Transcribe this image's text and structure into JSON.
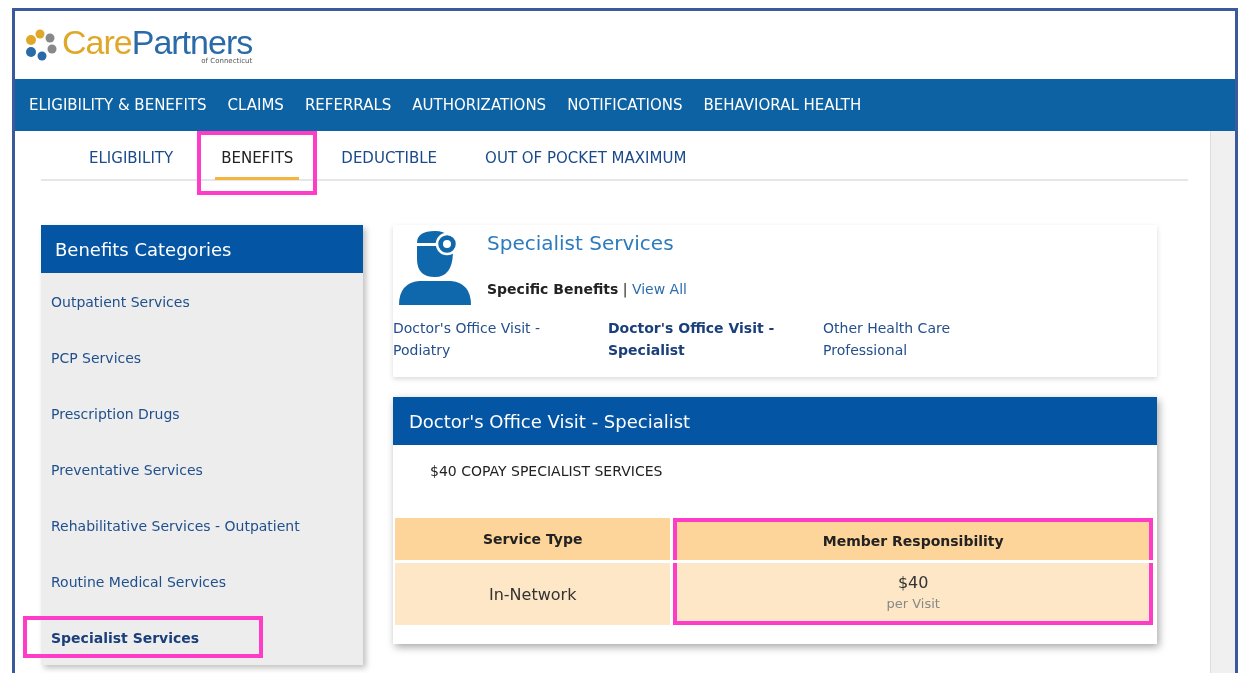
{
  "logo": {
    "first": "Care",
    "second": "Partners",
    "tagline": "of Connecticut"
  },
  "nav": [
    "ELIGIBILITY & BENEFITS",
    "CLAIMS",
    "REFERRALS",
    "AUTHORIZATIONS",
    "NOTIFICATIONS",
    "BEHAVIORAL HEALTH"
  ],
  "tabs": [
    {
      "label": "ELIGIBILITY",
      "selected": false,
      "highlighted": false
    },
    {
      "label": "BENEFITS",
      "selected": true,
      "highlighted": true
    },
    {
      "label": "DEDUCTIBLE",
      "selected": false,
      "highlighted": false
    },
    {
      "label": "OUT OF POCKET MAXIMUM",
      "selected": false,
      "highlighted": false
    }
  ],
  "sidebar": {
    "title": "Benefits Categories",
    "items": [
      {
        "label": "Outpatient Services",
        "selected": false,
        "highlighted": false
      },
      {
        "label": "PCP Services",
        "selected": false,
        "highlighted": false
      },
      {
        "label": "Prescription Drugs",
        "selected": false,
        "highlighted": false
      },
      {
        "label": "Preventative Services",
        "selected": false,
        "highlighted": false
      },
      {
        "label": "Rehabilitative Services - Outpatient",
        "selected": false,
        "highlighted": false
      },
      {
        "label": "Routine Medical Services",
        "selected": false,
        "highlighted": false
      },
      {
        "label": "Specialist Services",
        "selected": true,
        "highlighted": true
      }
    ]
  },
  "category": {
    "title": "Specialist Services",
    "filter_label": "Specific Benefits",
    "separator": "|",
    "view_all": "View All",
    "benefits": [
      {
        "label": "Doctor's Office Visit - Podiatry",
        "selected": false
      },
      {
        "label": "Doctor's Office Visit - Specialist",
        "selected": true
      },
      {
        "label": "Other Health Care Professional",
        "selected": false
      }
    ]
  },
  "detail": {
    "title": "Doctor's Office Visit - Specialist",
    "summary": "$40 COPAY SPECIALIST SERVICES",
    "table": {
      "columns": [
        {
          "label": "Service Type",
          "highlighted": false
        },
        {
          "label": "Member Responsibility",
          "highlighted": true
        }
      ],
      "rows": [
        {
          "service_type": "In-Network",
          "amount": "$40",
          "unit": "per Visit"
        }
      ]
    }
  }
}
